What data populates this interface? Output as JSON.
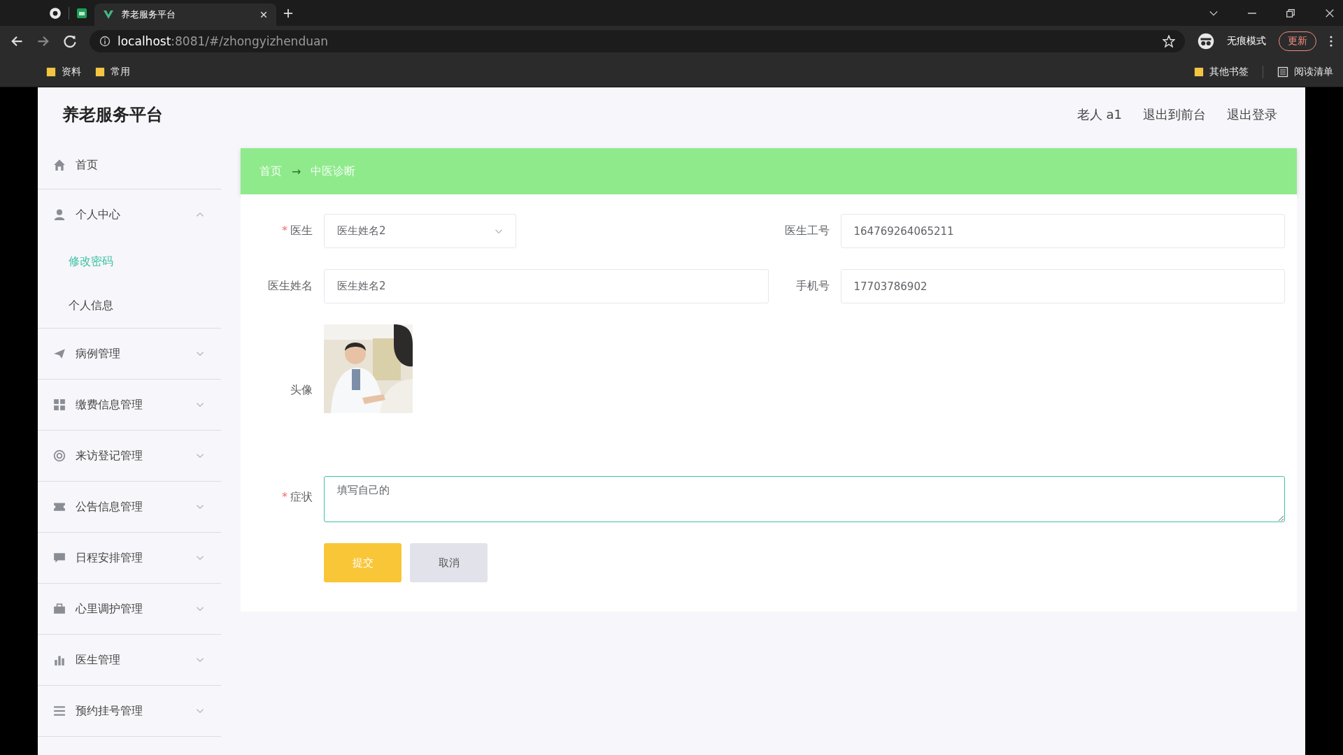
{
  "browser": {
    "tabs": [
      {
        "title": "养老服务平台",
        "selected": true
      }
    ],
    "address": {
      "host": "localhost",
      "path": ":8081/#/zhongyizhenduan"
    },
    "incognito_label": "无痕模式",
    "update_button": "更新",
    "bookmarks": [
      "资料",
      "常用"
    ],
    "right_bookmarks": [
      {
        "label": "其他书签",
        "kind": "folder"
      },
      {
        "label": "阅读清单",
        "kind": "list"
      }
    ]
  },
  "app": {
    "title": "养老服务平台",
    "header_links": [
      "老人 a1",
      "退出到前台",
      "退出登录"
    ],
    "sidebar": [
      {
        "label": "首页",
        "kind": "link"
      },
      {
        "label": "个人中心",
        "kind": "group",
        "expanded": true,
        "children": [
          {
            "label": "修改密码",
            "selected": true
          },
          {
            "label": "个人信息",
            "selected": false
          }
        ]
      },
      {
        "label": "病例管理",
        "kind": "group",
        "expanded": false
      },
      {
        "label": "缴费信息管理",
        "kind": "group",
        "expanded": false
      },
      {
        "label": "来访登记管理",
        "kind": "group",
        "expanded": false
      },
      {
        "label": "公告信息管理",
        "kind": "group",
        "expanded": false
      },
      {
        "label": "日程安排管理",
        "kind": "group",
        "expanded": false
      },
      {
        "label": "心里调护管理",
        "kind": "group",
        "expanded": false
      },
      {
        "label": "医生管理",
        "kind": "group",
        "expanded": false
      },
      {
        "label": "预约挂号管理",
        "kind": "group",
        "expanded": false
      }
    ],
    "breadcrumb": {
      "items": [
        "首页",
        "中医诊断"
      ],
      "separator": "→"
    },
    "form": {
      "required_mark": "*",
      "rows": [
        [
          {
            "label": "医生",
            "required": true,
            "kind": "select",
            "value": "医生姓名2"
          },
          {
            "label": "医生工号",
            "required": false,
            "kind": "input",
            "value": "164769264065211"
          }
        ],
        [
          {
            "label": "医生姓名",
            "required": false,
            "kind": "input",
            "value": "医生姓名2"
          },
          {
            "label": "手机号",
            "required": false,
            "kind": "input",
            "value": "17703786902"
          }
        ]
      ],
      "avatar": {
        "label": "头像",
        "kind": "picture"
      },
      "symptom": {
        "label": "症状",
        "required": true,
        "value": "填写自己的",
        "focused": true
      },
      "buttons": [
        {
          "label": "提交",
          "kind": "primary"
        },
        {
          "label": "取消",
          "kind": "secondary"
        }
      ]
    }
  }
}
